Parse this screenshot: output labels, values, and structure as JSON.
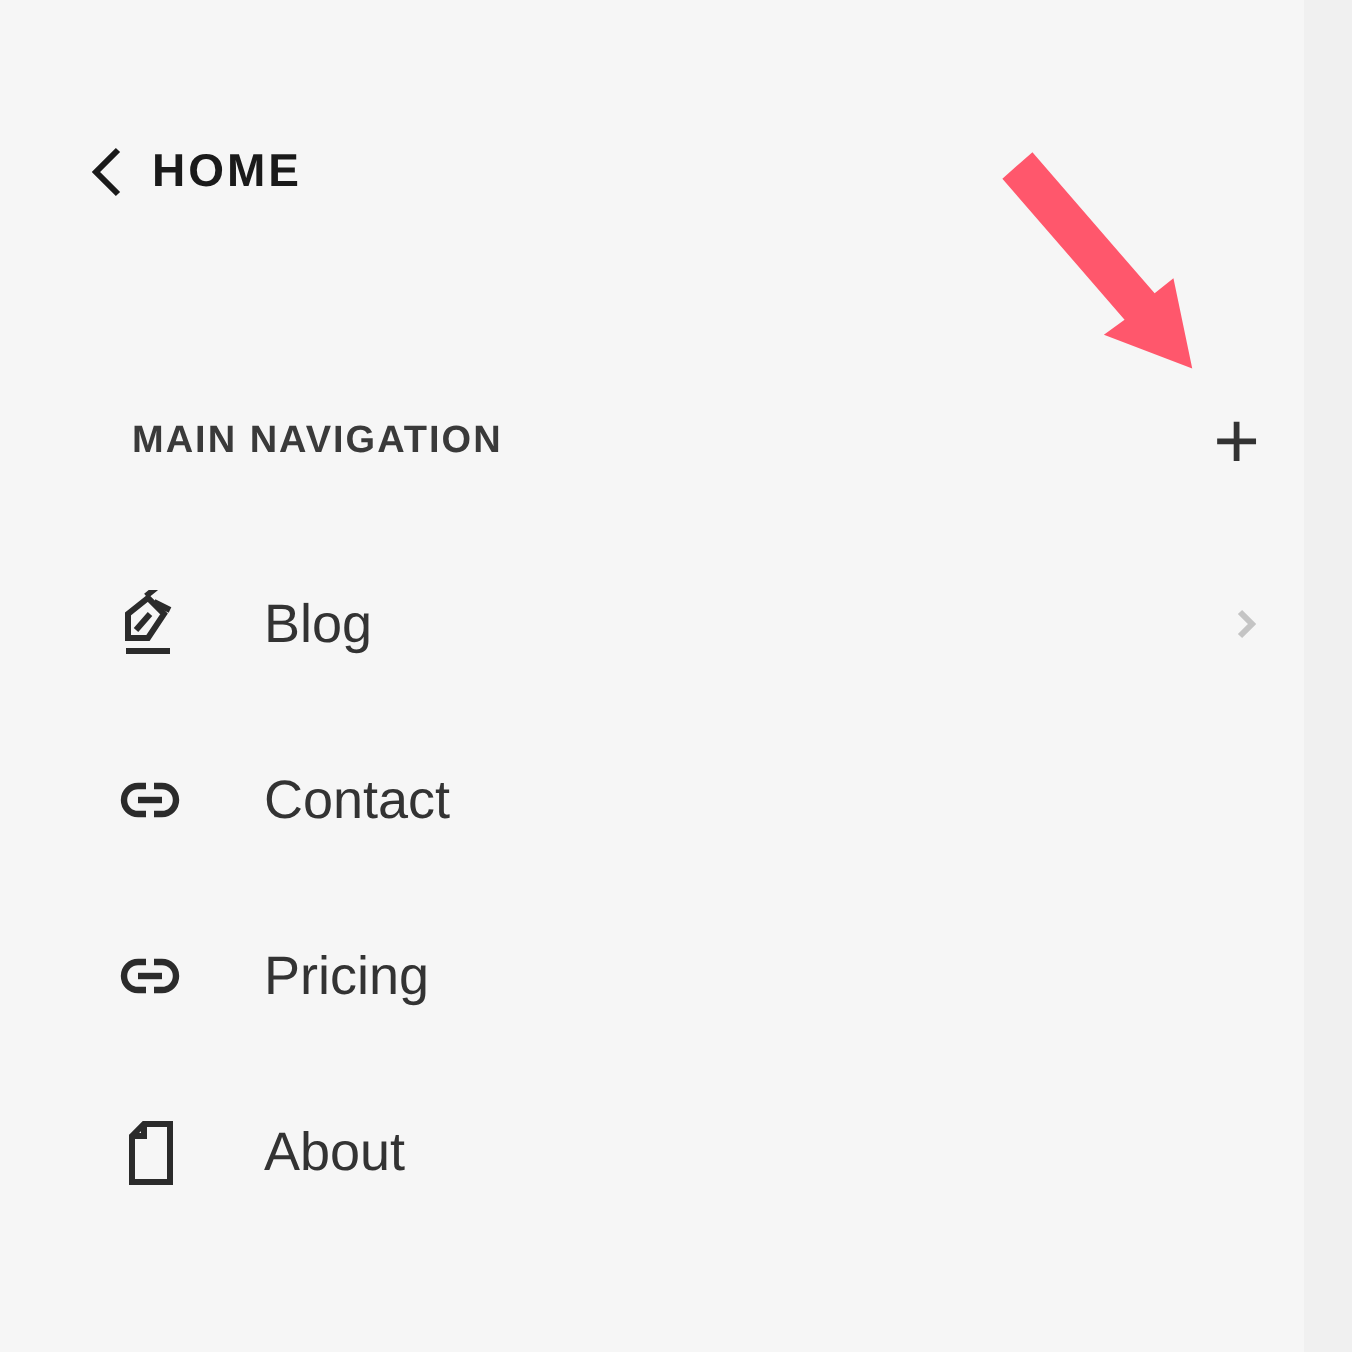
{
  "back_link": {
    "label": "HOME"
  },
  "section": {
    "title": "MAIN NAVIGATION",
    "add_icon": "+"
  },
  "items": [
    {
      "label": "Blog",
      "kind": "blog",
      "expandable": true
    },
    {
      "label": "Contact",
      "kind": "link",
      "expandable": false
    },
    {
      "label": "Pricing",
      "kind": "link",
      "expandable": false
    },
    {
      "label": "About",
      "kind": "page",
      "expandable": false
    }
  ],
  "annotation": {
    "kind": "arrow"
  }
}
